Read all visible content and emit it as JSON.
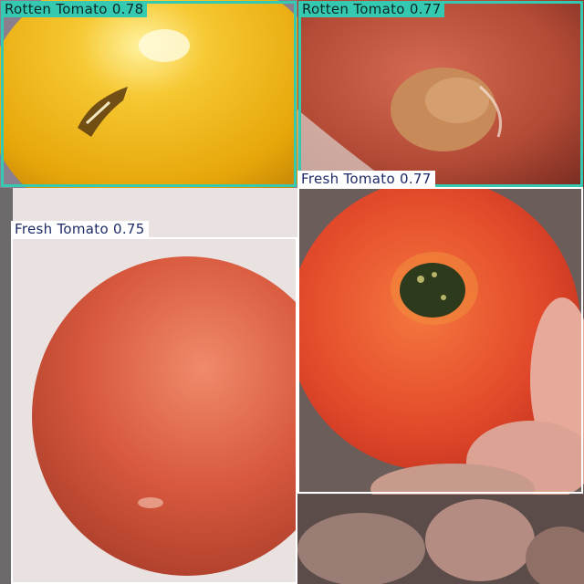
{
  "detections": [
    {
      "label": "Rotten Tomato 0.78",
      "color": "#36c9b2",
      "text_color": "#0b2a26"
    },
    {
      "label": "Rotten Tomato 0.77",
      "color": "#36c9b2",
      "text_color": "#0b2a26"
    },
    {
      "label": "Fresh Tomato 0.77",
      "color": "#ffffff",
      "text_color": "#1f2a66"
    },
    {
      "label": "Fresh Tomato 0.75",
      "color": "#ffffff",
      "text_color": "#1f2a66"
    }
  ]
}
